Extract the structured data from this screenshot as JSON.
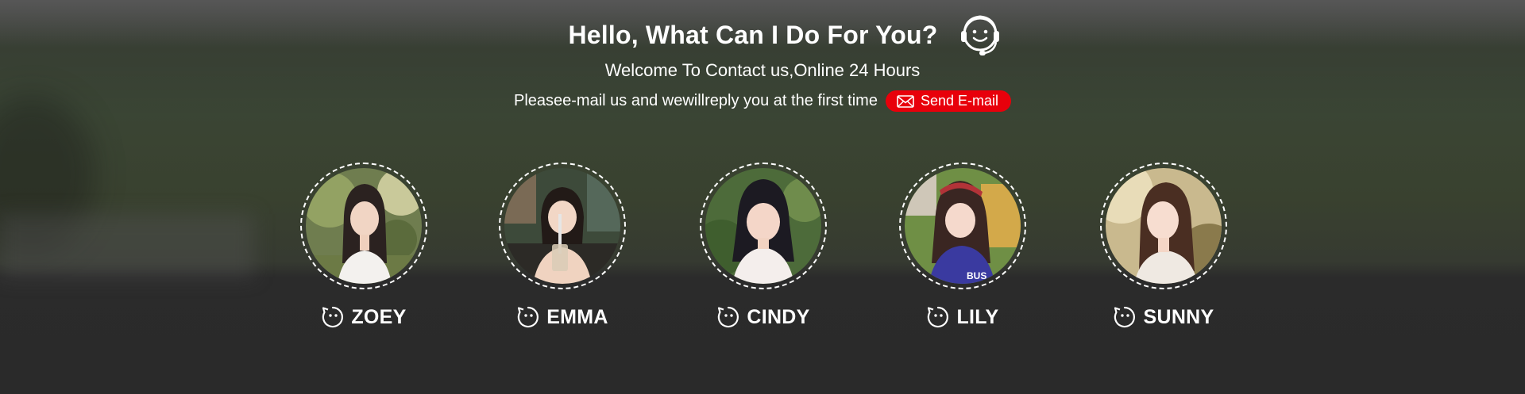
{
  "header": {
    "title": "Hello, What Can I Do For You?",
    "subtitle": "Welcome To Contact us,Online 24 Hours",
    "email_prompt": "Pleasee-mail us and wewillreply you at the first time",
    "send_email_label": "Send E-mail",
    "support_icon": "customer-service-headset-icon"
  },
  "colors": {
    "accent": "#e8000b",
    "text": "#ffffff",
    "footer_bg": "#2a2a2a"
  },
  "team": {
    "members": [
      {
        "name": "ZOEY",
        "icon": "chat-face-icon"
      },
      {
        "name": "EMMA",
        "icon": "chat-face-icon"
      },
      {
        "name": "CINDY",
        "icon": "chat-face-icon"
      },
      {
        "name": "LILY",
        "icon": "chat-face-icon"
      },
      {
        "name": "SUNNY",
        "icon": "chat-face-icon"
      }
    ]
  }
}
